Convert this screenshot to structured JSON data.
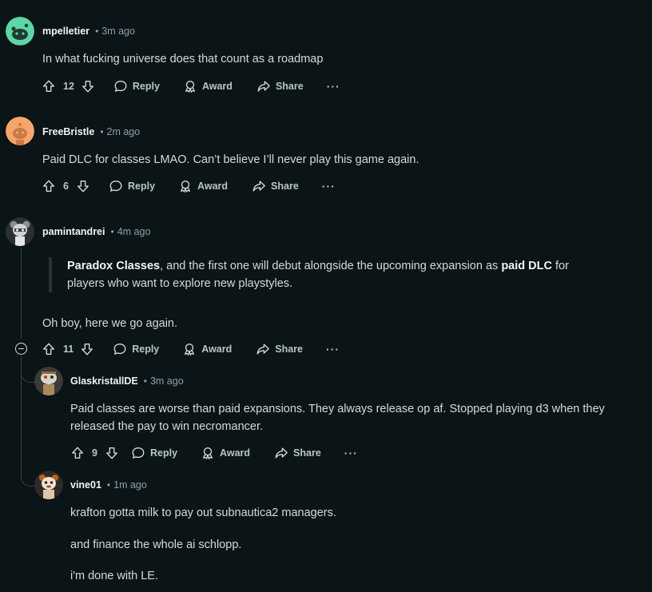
{
  "comments": [
    {
      "author": "mpelletier",
      "time": "3m ago",
      "avatar_icon": "snoo-avatar-green",
      "body": "In what fucking universe does that count as a roadmap",
      "votes": "12",
      "actions": {
        "reply": "Reply",
        "award": "Award",
        "share": "Share",
        "more": "···"
      }
    },
    {
      "author": "FreeBristle",
      "time": "2m ago",
      "avatar_icon": "snoo-avatar-orange",
      "body": "Paid DLC for classes LMAO. Can’t believe I’ll never play this game again.",
      "votes": "6",
      "actions": {
        "reply": "Reply",
        "award": "Award",
        "share": "Share",
        "more": "···"
      }
    },
    {
      "author": "pamintandrei",
      "time": "4m ago",
      "avatar_icon": "snoo-avatar-custom",
      "quote": {
        "part1_bold": "Paradox Classes",
        "part2": ", and the first one will debut alongside the upcoming expansion as ",
        "part3_bold": "paid DLC",
        "part4": " for",
        "line2": "players who want to explore new playstyles."
      },
      "body": "Oh boy, here we go again.",
      "votes": "11",
      "actions": {
        "reply": "Reply",
        "award": "Award",
        "share": "Share",
        "more": "···"
      },
      "replies": [
        {
          "author": "GlaskristallDE",
          "time": "3m ago",
          "avatar_icon": "snoo-avatar-custom-2",
          "body_line1": "Paid classes are worse than paid expansions. They always release op af. Stopped playing d3 when they",
          "body_line2": "released the pay to win necromancer.",
          "votes": "9",
          "actions": {
            "reply": "Reply",
            "award": "Award",
            "share": "Share",
            "more": "···"
          }
        },
        {
          "author": "vine01",
          "time": "1m ago",
          "avatar_icon": "snoo-avatar-custom-3",
          "paragraphs": [
            "krafton gotta milk to pay out subnautica2 managers.",
            "and finance the whole ai schlopp.",
            "i'm done with LE."
          ]
        }
      ]
    }
  ],
  "colors": {
    "background": "#0b1416",
    "text": "#d7dadc",
    "meta": "#8ba2ad",
    "thread_line": "#33404a"
  }
}
